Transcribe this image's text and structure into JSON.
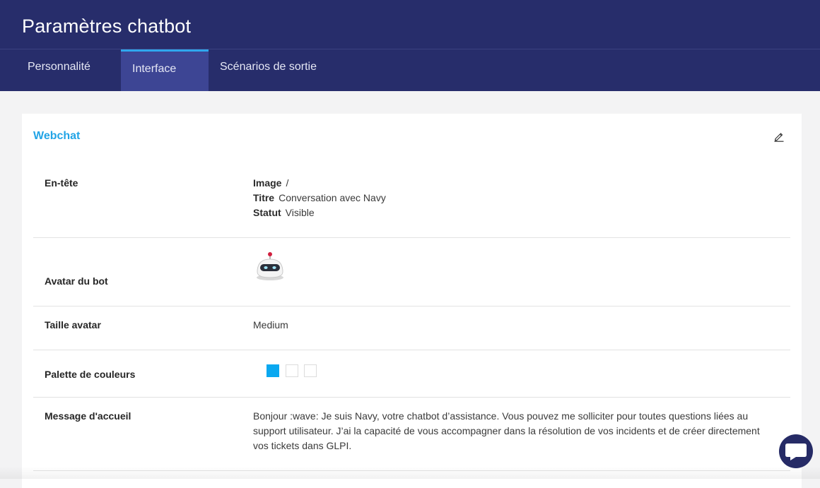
{
  "header": {
    "title": "Paramètres chatbot"
  },
  "tabs": [
    {
      "label": "Personnalité",
      "active": false
    },
    {
      "label": "Interface",
      "active": true
    },
    {
      "label": "Scénarios de sortie",
      "active": false
    }
  ],
  "card": {
    "title": "Webchat",
    "edit_icon": "pencil-icon",
    "rows": {
      "header_section": {
        "label": "En-tête",
        "image_key": "Image",
        "image_value": "/",
        "title_key": "Titre",
        "title_value": "Conversation avec Navy",
        "status_key": "Statut",
        "status_value": "Visible"
      },
      "avatar": {
        "label": "Avatar du bot",
        "icon": "robot-avatar-icon"
      },
      "avatar_size": {
        "label": "Taille avatar",
        "value": "Medium"
      },
      "palette": {
        "label": "Palette de couleurs",
        "colors": [
          "#0aa8f0",
          "#ffffff",
          "#ffffff"
        ]
      },
      "welcome": {
        "label": "Message d'accueil",
        "value": "Bonjour :wave: Je suis Navy, votre chatbot d’assistance. Vous pouvez me solliciter pour toutes questions liées au support utilisateur. J’ai la capacité de vous accompagner dans la résolution de vos incidents et de créer directement vos tickets dans GLPI."
      }
    }
  },
  "chat_button": {
    "icon": "chat-bubble-icon"
  }
}
